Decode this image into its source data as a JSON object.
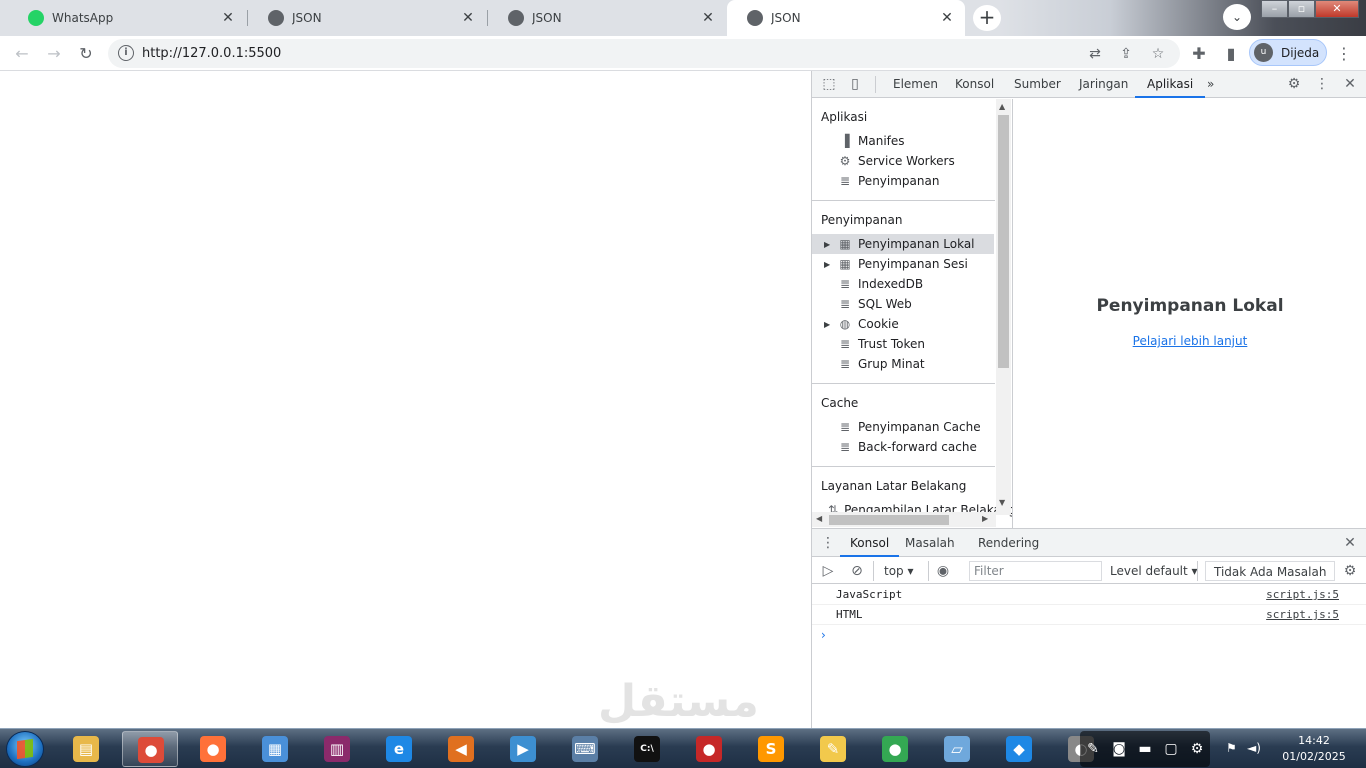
{
  "browser": {
    "tabs": [
      {
        "title": "WhatsApp",
        "favicon": "whatsapp-icon",
        "color": "#25d366",
        "active": false
      },
      {
        "title": "JSON",
        "favicon": "globe-icon",
        "color": "#5f6368",
        "active": false
      },
      {
        "title": "JSON",
        "favicon": "globe-icon",
        "color": "#5f6368",
        "active": false
      },
      {
        "title": "JSON",
        "favicon": "globe-icon",
        "color": "#5f6368",
        "active": true
      }
    ],
    "url": "http://127.0.0.1:5500",
    "profile_initial": "u",
    "profile_name": "Dijeda"
  },
  "devtools": {
    "tabs": [
      "Elemen",
      "Konsol",
      "Sumber",
      "Jaringan",
      "Aplikasi"
    ],
    "active_tab": "Aplikasi",
    "more": "»",
    "sidebar": {
      "sections": [
        {
          "heading": "Aplikasi",
          "items": [
            {
              "label": "Manifes",
              "icon": "file-icon"
            },
            {
              "label": "Service Workers",
              "icon": "gear-icon"
            },
            {
              "label": "Penyimpanan",
              "icon": "database-icon"
            }
          ]
        },
        {
          "heading": "Penyimpanan",
          "items": [
            {
              "label": "Penyimpanan Lokal",
              "icon": "grid-icon",
              "expandable": true,
              "selected": true
            },
            {
              "label": "Penyimpanan Sesi",
              "icon": "grid-icon",
              "expandable": true
            },
            {
              "label": "IndexedDB",
              "icon": "database-icon"
            },
            {
              "label": "SQL Web",
              "icon": "database-icon"
            },
            {
              "label": "Cookie",
              "icon": "cookie-icon",
              "expandable": true
            },
            {
              "label": "Trust Token",
              "icon": "database-icon"
            },
            {
              "label": "Grup Minat",
              "icon": "database-icon"
            }
          ]
        },
        {
          "heading": "Cache",
          "items": [
            {
              "label": "Penyimpanan Cache",
              "icon": "database-icon"
            },
            {
              "label": "Back-forward cache",
              "icon": "database-icon"
            }
          ]
        },
        {
          "heading": "Layanan Latar Belakang",
          "items": [
            {
              "label": "Pengambilan Latar Belakang",
              "icon": "arrows-icon"
            }
          ]
        }
      ]
    },
    "main": {
      "title": "Penyimpanan Lokal",
      "link": "Pelajari lebih lanjut"
    },
    "drawer": {
      "tabs": [
        "Konsol",
        "Masalah",
        "Rendering"
      ],
      "active_tab": "Konsol",
      "context": "top",
      "filter_placeholder": "Filter",
      "level": "Level default",
      "issues": "Tidak Ada Masalah",
      "messages": [
        {
          "text": "JavaScript",
          "source": "script.js:5"
        },
        {
          "text": "HTML",
          "source": "script.js:5"
        }
      ],
      "prompt": "›"
    }
  },
  "watermark": "مستقل",
  "taskbar": {
    "apps": [
      {
        "name": "explorer",
        "glyph": "▤",
        "color": "#e8b84a"
      },
      {
        "name": "chrome",
        "glyph": "●",
        "color": "#dd4b39",
        "open": true
      },
      {
        "name": "firefox",
        "glyph": "●",
        "color": "#ff7139"
      },
      {
        "name": "control-panel",
        "glyph": "▦",
        "color": "#4a90d9"
      },
      {
        "name": "winrar",
        "glyph": "▥",
        "color": "#8b2a6b"
      },
      {
        "name": "internet-explorer",
        "glyph": "e",
        "color": "#1e88e5"
      },
      {
        "name": "audio",
        "glyph": "◀",
        "color": "#e07020"
      },
      {
        "name": "media-player",
        "glyph": "▶",
        "color": "#3d8fd1"
      },
      {
        "name": "keyboard",
        "glyph": "⌨",
        "color": "#5b7fa6"
      },
      {
        "name": "cmd",
        "glyph": "C:\\",
        "color": "#111111"
      },
      {
        "name": "record",
        "glyph": "●",
        "color": "#c62828"
      },
      {
        "name": "sublime",
        "glyph": "S",
        "color": "#ff9800"
      },
      {
        "name": "tools",
        "glyph": "✎",
        "color": "#f2c94c"
      },
      {
        "name": "chrome-2",
        "glyph": "●",
        "color": "#34a853"
      },
      {
        "name": "notepad",
        "glyph": "▱",
        "color": "#6fa8dc"
      },
      {
        "name": "vscode",
        "glyph": "◆",
        "color": "#1e88e5"
      },
      {
        "name": "app-extra",
        "glyph": "◐",
        "color": "#888888"
      }
    ],
    "time": "14:42",
    "date": "01/02/2025"
  }
}
